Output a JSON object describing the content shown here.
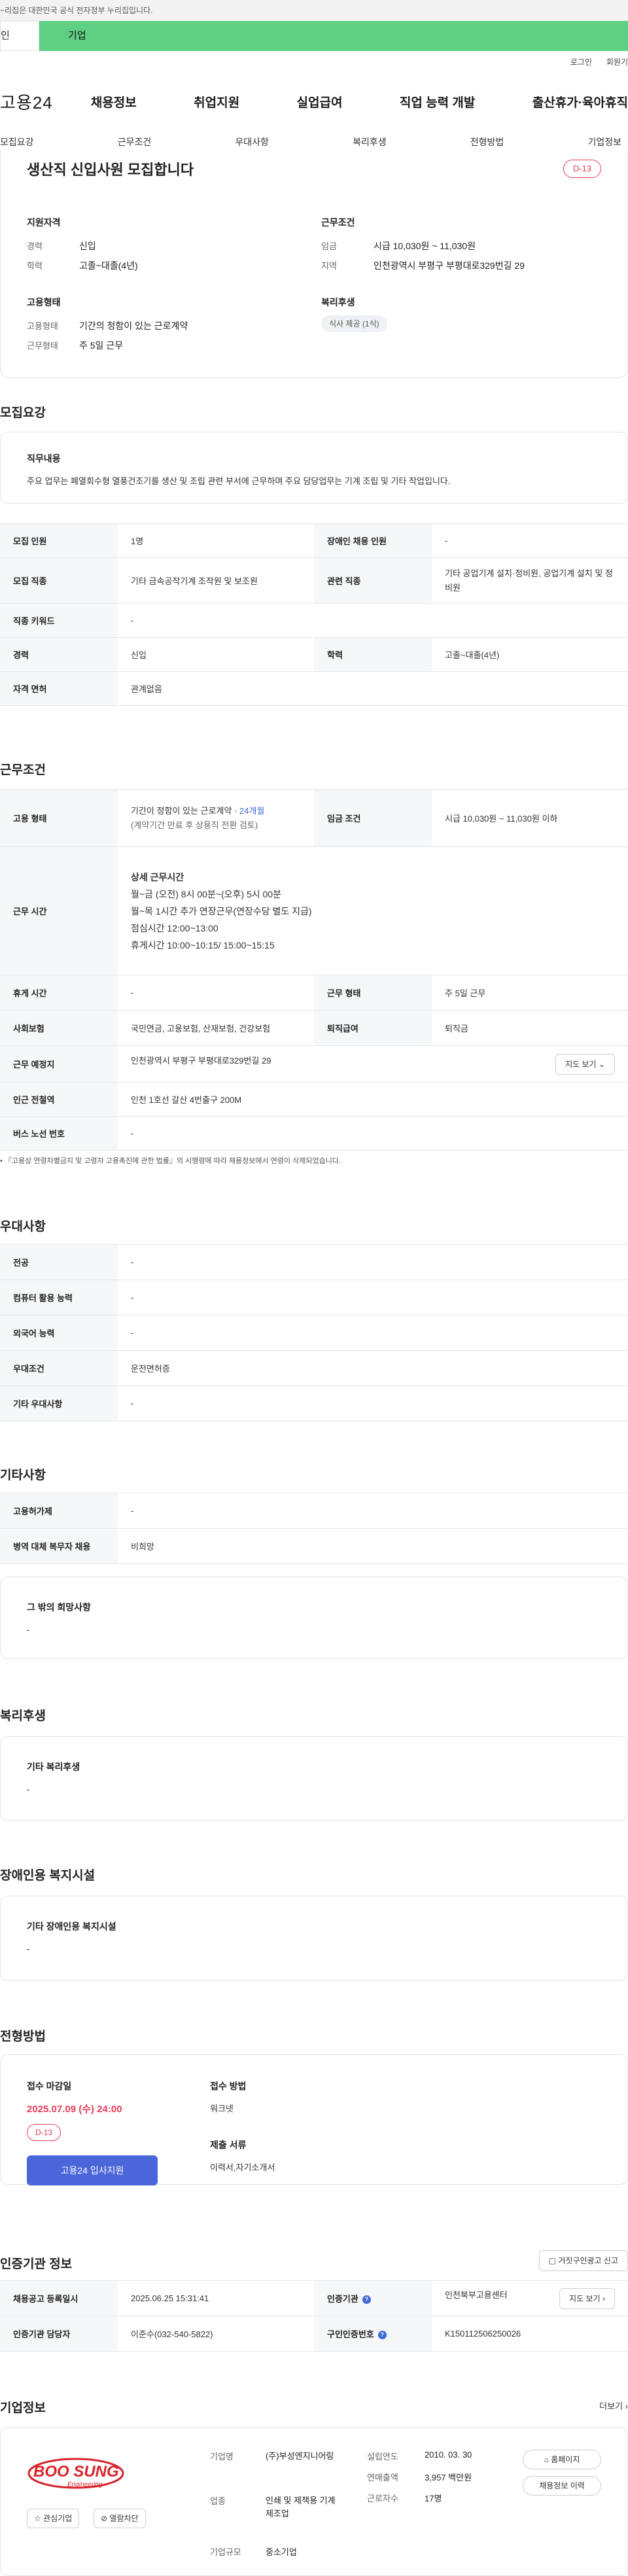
{
  "gov_bar": "~리집은 대한민국 공식 전자정부 누리집입니다.",
  "tabs": {
    "personal": "인",
    "company": "기업"
  },
  "util": {
    "login": "로그인",
    "join": "회원기"
  },
  "gnb": {
    "logo": "고용24",
    "items": [
      "채용정보",
      "취업지원",
      "실업급여",
      "직업 능력 개발",
      "출산휴가·육아휴직"
    ]
  },
  "subnav": [
    "모집요강",
    "근무조건",
    "우대사항",
    "복리후생",
    "전형방법",
    "기업정보"
  ],
  "summary": {
    "title": "생산직 신입사원 모집합니다",
    "dday": "D-13",
    "qualification": {
      "title": "지원자격",
      "career_label": "경력",
      "career": "신입",
      "edu_label": "학력",
      "edu": "고졸~대졸(4년)"
    },
    "employment": {
      "title": "고용형태",
      "type_label": "고용형태",
      "type": "기간의 정함이 있는 근로계약",
      "days_label": "근무형태",
      "days": "주 5일 근무"
    },
    "conditions": {
      "title": "근무조건",
      "wage_label": "임금",
      "wage": "시급 10,030원 ~ 11,030원",
      "region_label": "지역",
      "region": "인천광역시 부평구 부평대로329번길 29"
    },
    "welfare": {
      "title": "복리후생",
      "chip": "식사 제공 (1식)"
    }
  },
  "recruit": {
    "section": "모집요강",
    "duty_title": "직무내용",
    "duty_body": "주요 업무는 폐열회수형 열풍건조기를 생산 및 조립 관련 부서에 근무하며 주요 담당업무는 기계 조립 및 기타 작업입니다.",
    "rows": [
      {
        "h1": "모집 인원",
        "v1": "1명",
        "h2": "장애인 채용 인원",
        "v2": "-"
      },
      {
        "h1": "모집 직종",
        "v1": "기타 금속공작기계 조작원 및 보조원",
        "h2": "관련 직종",
        "v2": "기타 공업기계 설치·정비원, 공업기계 설치 및 정비원"
      },
      {
        "h1": "직종 키워드",
        "v1": "-"
      },
      {
        "h1": "경력",
        "v1": "신입",
        "h2": "학력",
        "v2": "고졸~대졸(4년)"
      },
      {
        "h1": "자격 면허",
        "v1": "관계없음"
      }
    ]
  },
  "work": {
    "section": "근무조건",
    "type_h": "고용 형태",
    "type_v1": "기간이 정함이 있는 근로계약 · ",
    "type_months": "24개월",
    "type_v2": "(계약기간 만료 후 상용직 전환 검토)",
    "wage_h": "임금 조건",
    "wage_v": "시급 10,030원 ~ 11,030원 이하",
    "hours_h": "근무 시간",
    "hours_title": "상세 근무시간",
    "hours_lines": [
      "월~금 (오전) 8시 00분~(오후) 5시 00분",
      "월~목 1시간 추가 연장근무(연장수당 별도 지급)",
      "점심시간 12:00~13:00",
      "휴게시간 10:00~10:15/ 15:00~15:15"
    ],
    "rest_h": "휴게 시간",
    "rest_v": "-",
    "form_h": "근무 형태",
    "form_v": "주 5일 근무",
    "ins_h": "사회보험",
    "ins_v": "국민연금, 고용보험, 산재보험, 건강보험",
    "ret_h": "퇴직급여",
    "ret_v": "퇴직금",
    "place_h": "근무 예정지",
    "place_v": "인천광역시 부평구 부평대로329번길 29",
    "map_btn": "지도 보기",
    "subway_h": "인근 전철역",
    "subway_v": "인천 1호선 갈산 4번출구 200M",
    "bus_h": "버스 노선 번호",
    "bus_v": "-",
    "notice": "『고용상 연령차별금지 및 고령자 고용촉진에 관한 법률』의 시행령에 따라 채용정보에서 연령이 삭제되었습니다."
  },
  "prefer": {
    "section": "우대사항",
    "rows": [
      {
        "h": "전공",
        "v": "-"
      },
      {
        "h": "컴퓨터 활용 능력",
        "v": "-"
      },
      {
        "h": "외국어 능력",
        "v": "-"
      },
      {
        "h": "우대조건",
        "v": "운전면허증"
      },
      {
        "h": "기타 우대사항",
        "v": "-"
      }
    ]
  },
  "other": {
    "section": "기타사항",
    "rows": [
      {
        "h": "고용허가제",
        "v": "-"
      },
      {
        "h": "병역 대체 복무자 채용",
        "v": "비희망"
      }
    ],
    "wish_title": "그 밖의 희망사항",
    "wish_value": "-"
  },
  "benefit": {
    "section": "복리후생",
    "title": "기타 복리후생",
    "value": "-"
  },
  "disability": {
    "section": "장애인용 복지시설",
    "title": "기타 장애인용 복지시설",
    "value": "-"
  },
  "selection": {
    "section": "전형방법",
    "deadline_title": "접수 마감일",
    "deadline": "2025.07.09 (수) 24:00",
    "dday": "D-13",
    "apply_btn": "고용24 입사지원",
    "method_title": "접수 방법",
    "method": "워크넷",
    "docs_title": "제출 서류",
    "docs": "이력서,자기소개서"
  },
  "agency": {
    "section": "인증기관 정보",
    "report_btn": "거짓구인광고 신고",
    "date_h": "채용공고 등록일시",
    "date_v": "2025.06.25 15:31:41",
    "org_h": "인증기관",
    "org_v": "인천북부고용센터",
    "map_btn": "지도 보기",
    "person_h": "인증기관 담당자",
    "person_v": "이준수(032-540-5822)",
    "num_h": "구인인증번호",
    "num_v": "K150112506250026"
  },
  "company": {
    "section": "기업정보",
    "more": "더보기",
    "logo_main": "BOO SUNG",
    "logo_sub": "Engineering",
    "interest_btn": "관심기업",
    "block_btn": "열람차단",
    "name_h": "기업명",
    "name_v": "(주)부성엔지니어링",
    "biz_h": "업종",
    "biz_v": "인쇄 및 제책용 기계 제조업",
    "scale_h": "기업규모",
    "scale_v": "중소기업",
    "est_h": "설립연도",
    "est_v": "2010. 03. 30",
    "sales_h": "연매출액",
    "sales_v": "3,957 백만원",
    "emp_h": "근로자수",
    "emp_v": "17명",
    "home_btn": "홈페이지",
    "jobs_btn": "채용정보 이력"
  },
  "colors": {
    "brand_green": "#5fcf83",
    "accent_red": "#e63d5a",
    "apply_blue": "#4a66d9",
    "link_blue": "#3d6ad6"
  }
}
